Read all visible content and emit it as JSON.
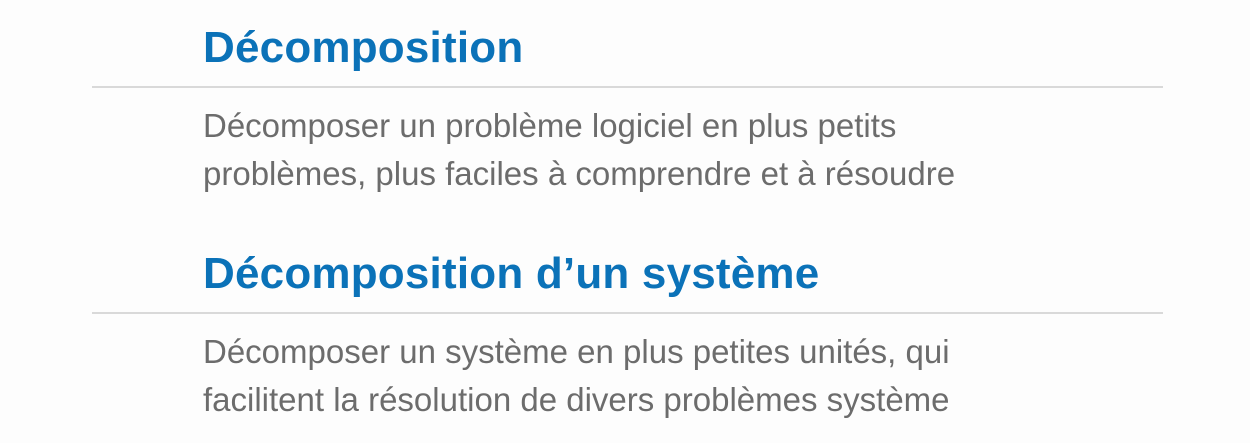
{
  "sections": [
    {
      "heading": "Décomposition",
      "lines": [
        "Décomposer un problème logiciel en plus petits",
        "problèmes, plus faciles à comprendre et à résoudre"
      ]
    },
    {
      "heading": "Décomposition d’un système",
      "lines": [
        "Décomposer un système en plus petites unités, qui",
        "facilitent la résolution de divers problèmes système"
      ]
    }
  ],
  "colors": {
    "heading": "#0b72b8",
    "body": "#6c6c6c",
    "rule": "#d9d9d9",
    "background": "#fdfdfd"
  }
}
